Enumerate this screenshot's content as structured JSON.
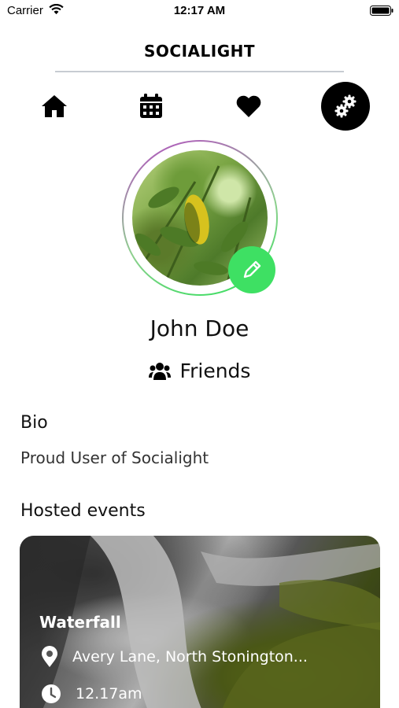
{
  "status_bar": {
    "carrier": "Carrier",
    "time": "12:17 AM"
  },
  "header": {
    "title": "SOCIALIGHT"
  },
  "tabs": [
    {
      "icon": "home-icon",
      "selected": false
    },
    {
      "icon": "calendar-icon",
      "selected": false
    },
    {
      "icon": "heart-icon",
      "selected": false
    },
    {
      "icon": "gears-icon",
      "selected": true
    }
  ],
  "profile": {
    "name": "John Doe",
    "relationship_label": "Friends"
  },
  "bio": {
    "heading": "Bio",
    "text": "Proud User of Socialight"
  },
  "hosted_events": {
    "heading": "Hosted events",
    "events": [
      {
        "title": "Waterfall",
        "location": "Avery Lane, North Stonington...",
        "time": "12.17am"
      }
    ]
  },
  "colors": {
    "accent_green": "#3ee063",
    "ring_purple": "#b54bc2",
    "active_tab_bg": "#000000",
    "divider": "#c7ccd2"
  }
}
